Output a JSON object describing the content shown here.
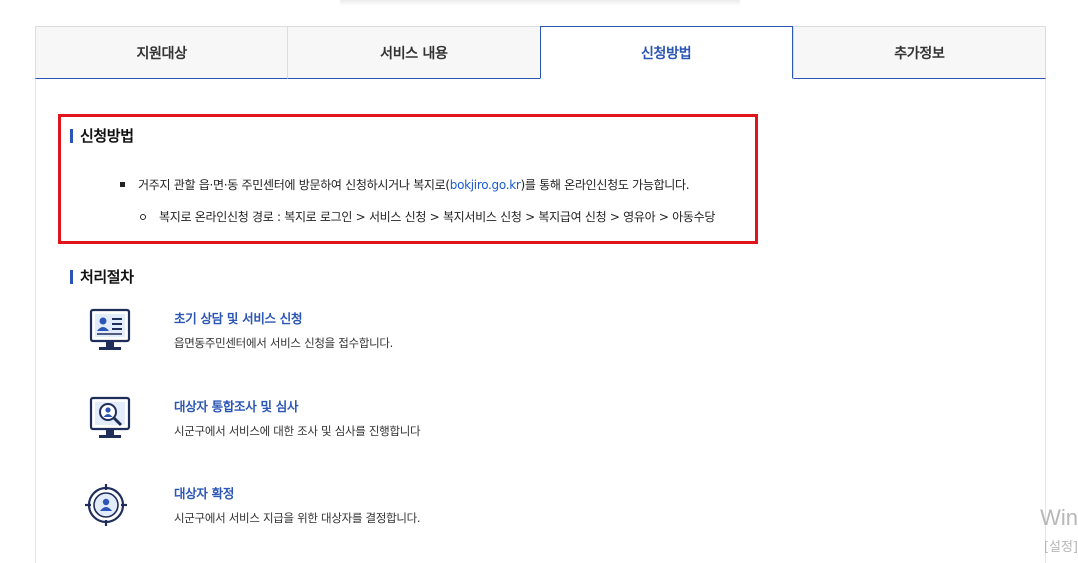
{
  "tabs": [
    {
      "label": "지원대상",
      "active": false
    },
    {
      "label": "서비스 내용",
      "active": false
    },
    {
      "label": "신청방법",
      "active": true
    },
    {
      "label": "추가정보",
      "active": false
    }
  ],
  "apply_section": {
    "title": "신청방법",
    "bullet1_pre": "거주지 관할 읍·면·동 주민센터에 방문하여 신청하시거나 복지로(",
    "bullet1_link": "bokjiro.go.kr",
    "bullet1_post": ")를 통해 온라인신청도 가능합니다.",
    "sub_bullet": "복지로 온라인신청 경로 : 복지로 로그인 > 서비스 신청 > 복지서비스 신청 > 복지급여 신청 > 영유아 > 아동수당"
  },
  "process_section": {
    "title": "처리절차",
    "steps": [
      {
        "icon": "monitor-profile-icon",
        "title": "초기 상담 및 서비스 신청",
        "desc": "읍면동주민센터에서 서비스 신청을 접수합니다."
      },
      {
        "icon": "monitor-search-person-icon",
        "title": "대상자 통합조사 및 심사",
        "desc": "시군구에서 서비스에 대한 조사 및 심사를 진행합니다"
      },
      {
        "icon": "target-person-icon",
        "title": "대상자 확정",
        "desc": "시군구에서 서비스 지급을 위한 대상자를 결정합니다."
      }
    ]
  },
  "overlay": {
    "watermark": "Win",
    "watermark_sub": "[설정]"
  },
  "colors": {
    "accent": "#2b56b5",
    "link": "#1a5bd3",
    "highlight": "#e1141b"
  }
}
